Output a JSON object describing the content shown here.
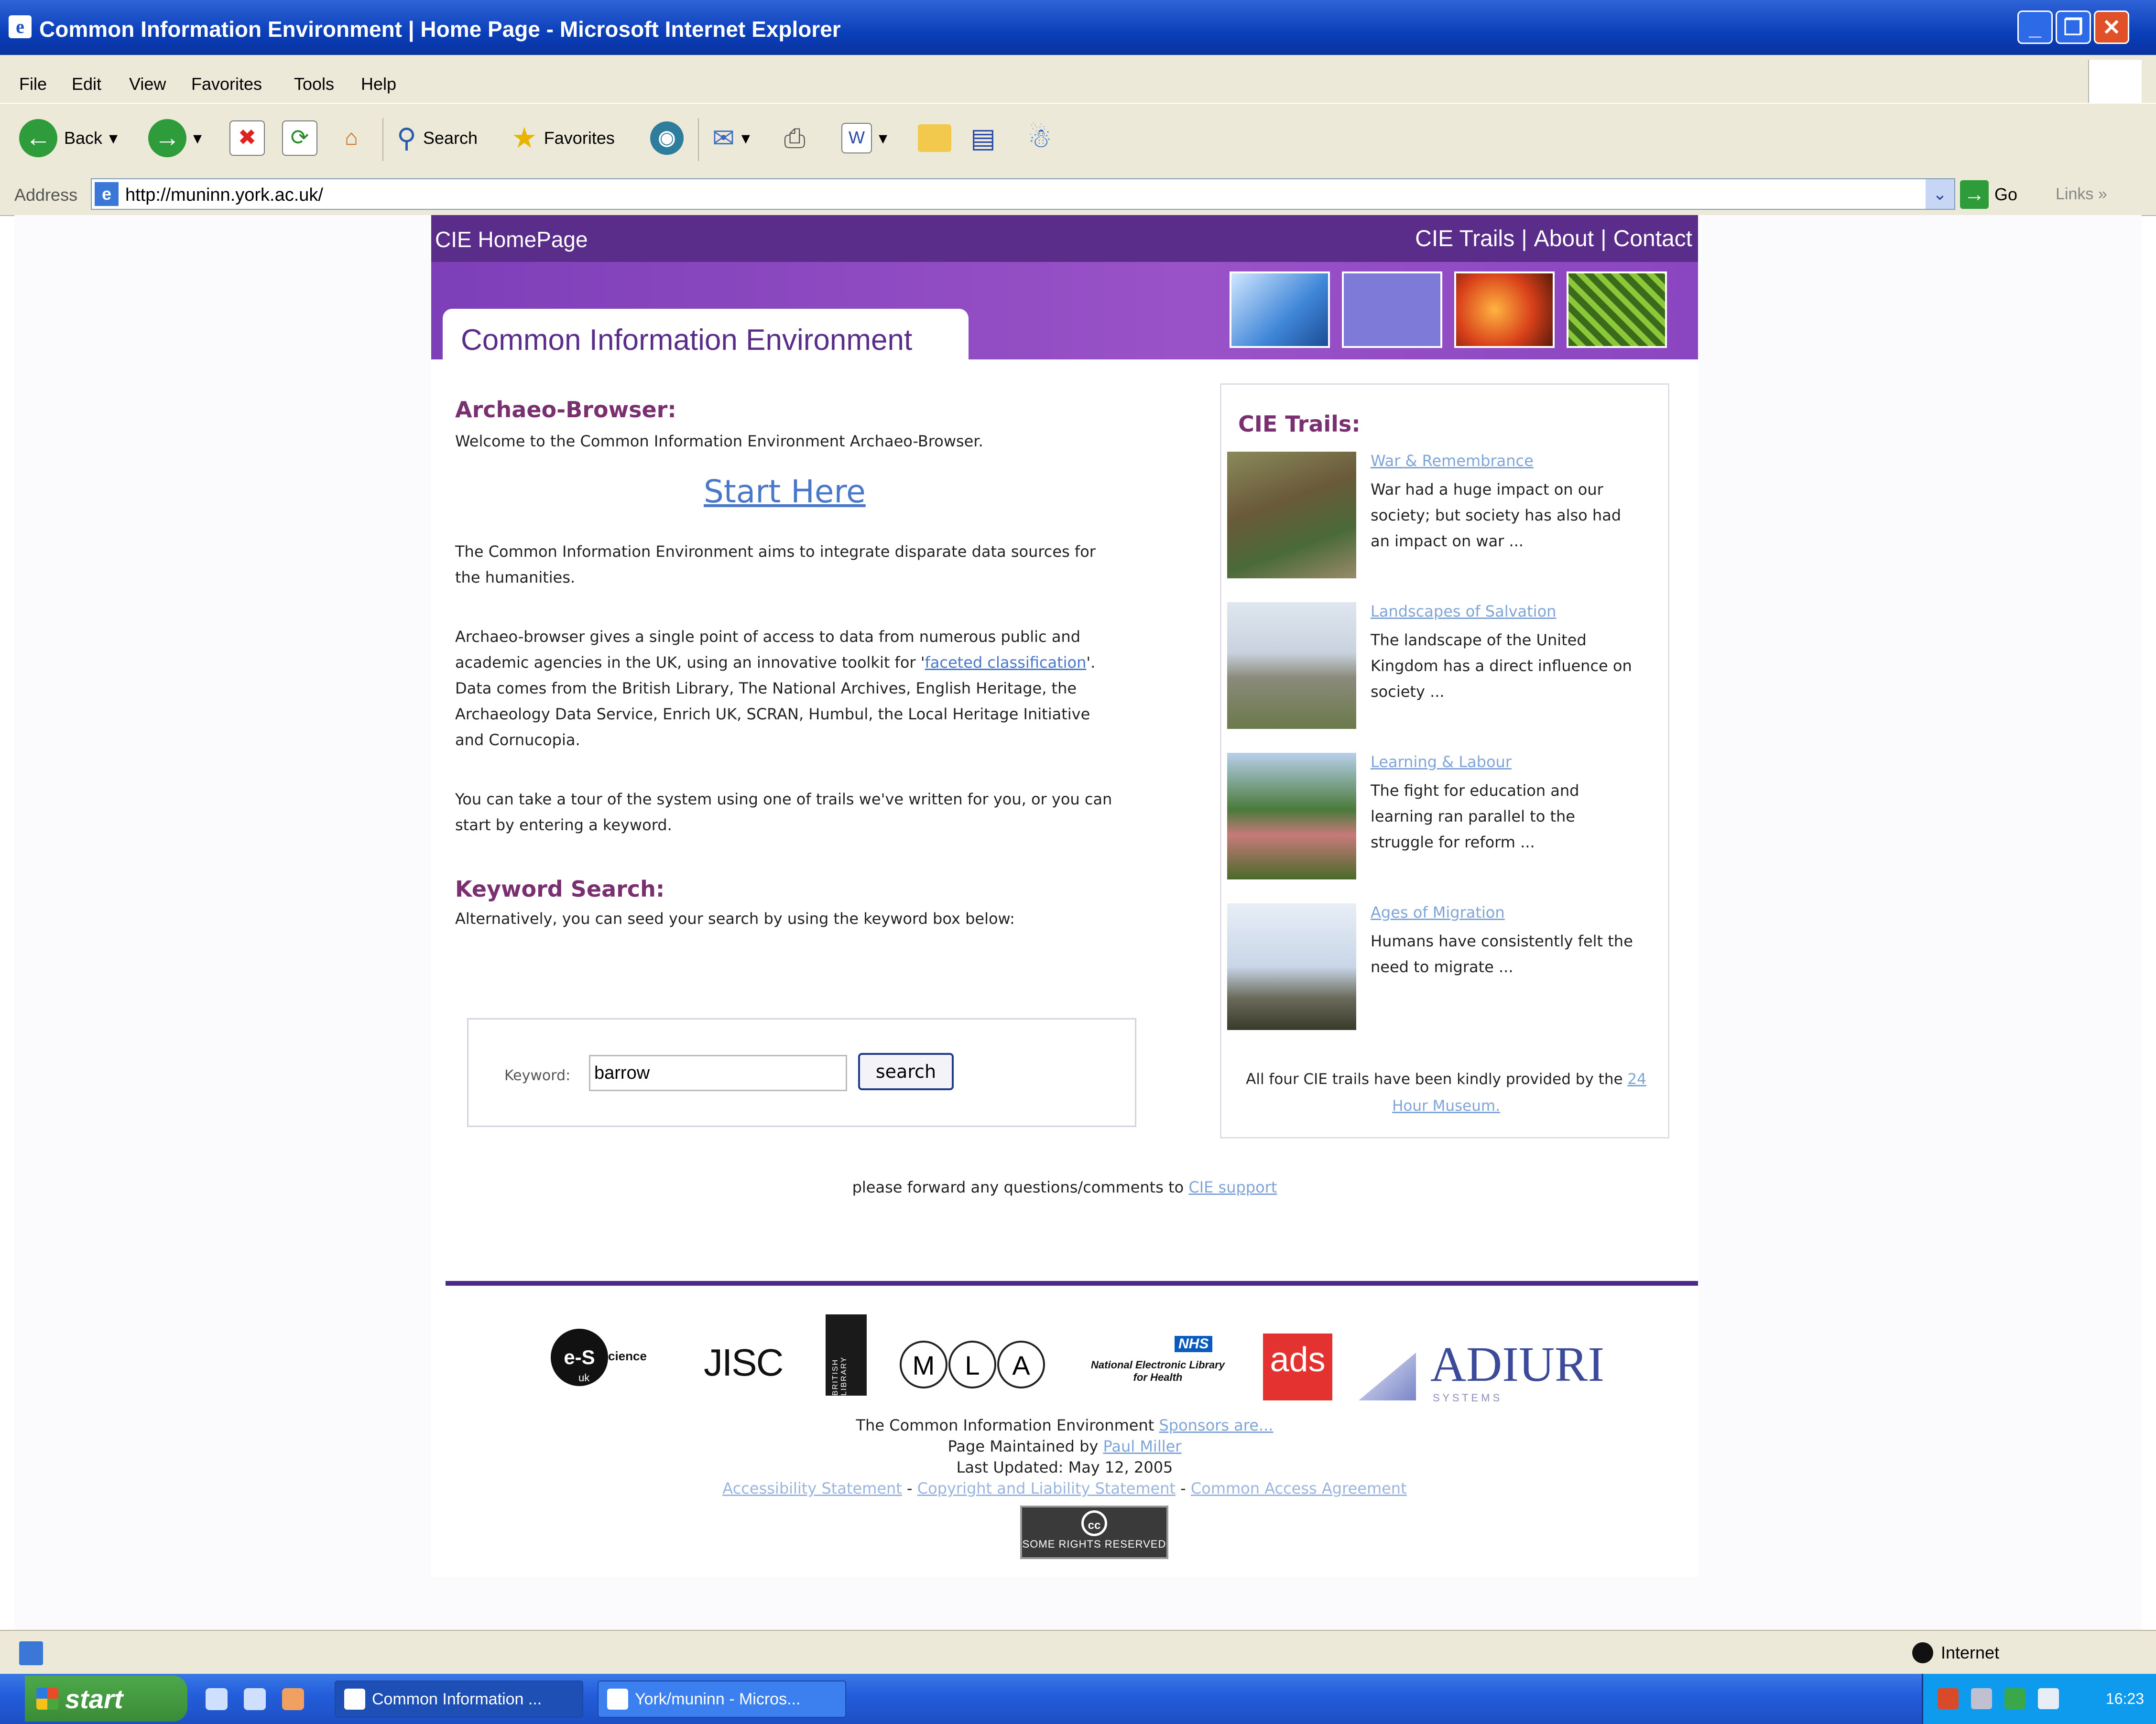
{
  "window": {
    "title": "Common Information Environment | Home Page - Microsoft Internet Explorer",
    "controls": [
      "minimize",
      "restore",
      "close"
    ]
  },
  "menu": [
    "File",
    "Edit",
    "View",
    "Favorites",
    "Tools",
    "Help"
  ],
  "toolbar": {
    "back_label": "Back",
    "search_label": "Search",
    "favorites_label": "Favorites"
  },
  "address": {
    "label": "Address",
    "url": "http://muninn.york.ac.uk/",
    "go_label": "Go",
    "links_label": "Links"
  },
  "site": {
    "nav": {
      "home": "CIE HomePage",
      "links": [
        "CIE Trails",
        "About",
        "Contact"
      ]
    },
    "banner_title": "Common Information Environment",
    "archaeo": {
      "heading": "Archaeo-Browser:",
      "welcome": "Welcome to the Common Information Environment Archaeo-Browser.",
      "start_here": "Start Here",
      "aims": "The Common Information Environment aims to integrate disparate data sources for the humanities.",
      "access_pre": "Archaeo-browser gives a single point of access to data from numerous public and academic agencies in the UK, using an innovative toolkit for '",
      "access_link": "faceted classification",
      "access_post": "'. Data comes from the British Library, The National Archives, English Heritage, the Archaeology Data Service, Enrich UK, SCRAN, Humbul, the Local Heritage Initiative and Cornucopia.",
      "tour": "You can take a tour of the system using one of trails we've written for you, or you can start by entering a keyword."
    },
    "keyword": {
      "heading": "Keyword Search:",
      "text": "Alternatively, you can seed your search by using the keyword box below:",
      "label": "Keyword:",
      "value": "barrow",
      "button": "search"
    },
    "trails": {
      "heading": "CIE Trails:",
      "items": [
        {
          "title": "War & Remembrance",
          "desc": "War had a huge impact on our society; but society has also had an impact on war ..."
        },
        {
          "title": "Landscapes of Salvation",
          "desc": "The landscape of the United Kingdom has a direct influence on society ..."
        },
        {
          "title": "Learning & Labour",
          "desc": "The fight for education and learning ran parallel to the struggle for reform ..."
        },
        {
          "title": "Ages of Migration",
          "desc": "Humans have consistently felt the need to migrate ..."
        }
      ],
      "credit_pre": "All four CIE trails have been kindly provided by the",
      "credit_link": "24 Hour Museum."
    },
    "forward_pre": "please forward any questions/comments to",
    "forward_link": "CIE support",
    "logos": {
      "escience_a": "e-S",
      "escience_b": "cience",
      "escience_c": "uk",
      "jisc": "JISC",
      "british_library": "BRITISH LIBRARY",
      "mla": [
        "M",
        "L",
        "A"
      ],
      "nhs_badge": "NHS",
      "nhs_text": "National Electronic Library for Health",
      "ads": "ads",
      "adiuri": "ADIURI",
      "adiuri_sub": "S Y S T E M S"
    },
    "footer": {
      "line1_pre": "The Common Information Environment",
      "line1_link": "Sponsors are...",
      "line2_pre": "Page Maintained by",
      "line2_link": "Paul Miller",
      "line3": "Last Updated: May 12, 2005",
      "links": [
        "Accessibility Statement",
        "Copyright and Liability Statement",
        "Common Access Agreement"
      ],
      "separator": " - ",
      "cc_symbol": "cc",
      "cc_label": "SOME RIGHTS RESERVED"
    }
  },
  "statusbar": {
    "zone": "Internet"
  },
  "taskbar": {
    "start": "start",
    "tasks": [
      "Common Information ...",
      "York/muninn - Micros..."
    ],
    "clock": "16:23"
  },
  "colors": {
    "nav_purple": "#5a2d8a",
    "banner_purple": "#9a52c8",
    "heading_plum": "#7a2f70",
    "link_blue": "#4a78c8"
  }
}
